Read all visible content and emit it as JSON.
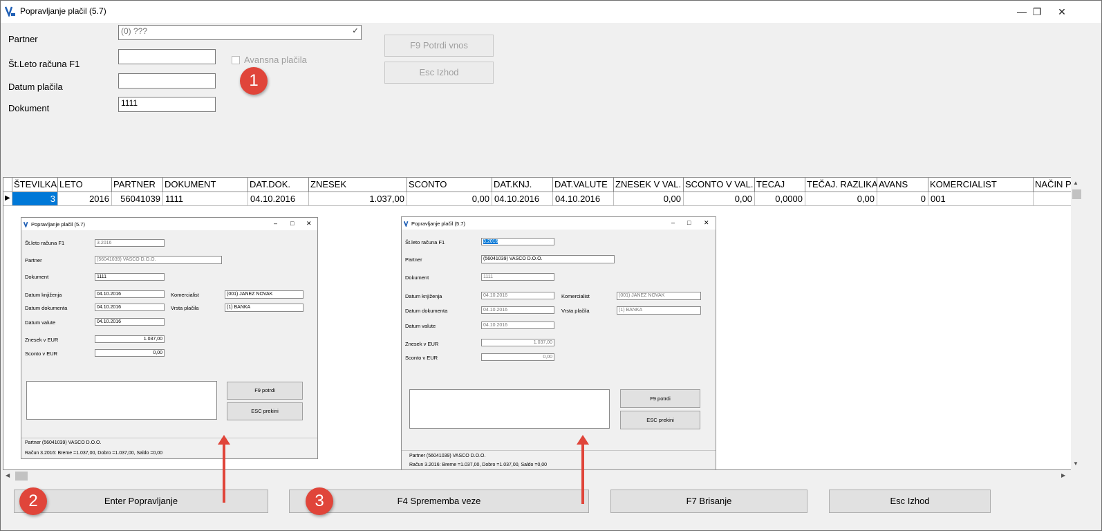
{
  "window": {
    "title": "Popravljanje plačil  (5.7)",
    "minimize": "—",
    "restore": "❐",
    "close": "✕"
  },
  "form": {
    "partner_label": "Partner",
    "partner_value": "(0) ???",
    "racun_label": "Št.Leto računa F1",
    "racun_value": "",
    "datum_label": "Datum plačila",
    "datum_value": "",
    "dokument_label": "Dokument",
    "dokument_value": "1111",
    "avansna_label": "Avansna plačila",
    "confirm_button": "F9  Potrdi vnos",
    "exit_button": "Esc  Izhod"
  },
  "grid": {
    "columns": [
      "ŠTEVILKA",
      "LETO",
      "PARTNER",
      "DOKUMENT",
      "DAT.DOK.",
      "ZNESEK",
      "SCONTO",
      "DAT.KNJ.",
      "DAT.VALUTE",
      "ZNESEK V VAL.",
      "SCONTO V VAL.",
      "TECAJ",
      "TEČAJ. RAZLIKA",
      "AVANS",
      "KOMERCIALIST",
      "NAČIN P"
    ],
    "rows": [
      [
        "3",
        "2016",
        "56041039",
        "1111",
        "04.10.2016",
        "1.037,00",
        "0,00",
        "04.10.2016",
        "04.10.2016",
        "0,00",
        "0,00",
        "0,0000",
        "0,00",
        "0",
        "001",
        ""
      ]
    ]
  },
  "dialog_left": {
    "title": "Popravljanje plačil  (5.7)",
    "racun_label": "Št.leto računa F1",
    "racun_value": "3.2016",
    "partner_label": "Partner",
    "partner_value": "(56041039) VASCO D.O.O.",
    "dokument_label": "Dokument",
    "dokument_value": "1111",
    "dknj_label": "Datum knjiženja",
    "dknj_value": "04.10.2016",
    "ddok_label": "Datum dokumenta",
    "ddok_value": "04.10.2016",
    "dval_label": "Datum valute",
    "dval_value": "04.10.2016",
    "kom_label": "Komercialist",
    "kom_value": "(001) JANEZ NOVAK",
    "vrsta_label": "Vrsta plačila",
    "vrsta_value": "(1) BANKA",
    "znesek_label": "Znesek v EUR",
    "znesek_value": "1.037,00",
    "sconto_label": "Sconto v EUR",
    "sconto_value": "0,00",
    "ok_button": "F9  potrdi",
    "cancel_button": "ESC  prekini",
    "status1": "Partner  (56041039) VASCO D.O.O.",
    "status2": "Račun  3.2016:  Breme =1.037,00,  Dobro =1.037,00,  Saldo =0,00"
  },
  "dialog_right": {
    "title": "Popravljanje plačil  (5.7)",
    "racun_label": "Št.leto računa F1",
    "racun_value": "3.2016",
    "partner_label": "Partner",
    "partner_value": "(56041039) VASCO D.O.O.",
    "dokument_label": "Dokument",
    "dokument_value": "1111",
    "dknj_label": "Datum knjiženja",
    "dknj_value": "04.10.2016",
    "ddok_label": "Datum dokumenta",
    "ddok_value": "04.10.2016",
    "dval_label": "Datum valute",
    "dval_value": "04.10.2016",
    "kom_label": "Komercialist",
    "kom_value": "(001) JANEZ NOVAK",
    "vrsta_label": "Vrsta plačila",
    "vrsta_value": "(1) BANKA",
    "znesek_label": "Znesek v EUR",
    "znesek_value": "1.037,00",
    "sconto_label": "Sconto v EUR",
    "sconto_value": "0,00",
    "ok_button": "F9  potrdi",
    "cancel_button": "ESC  prekini",
    "status1": "Partner  (56041039) VASCO D.O.O.",
    "status2": "Račun  3.2016:  Breme =1.037,00,  Dobro =1.037,00,  Saldo =0,00"
  },
  "bottom_buttons": {
    "edit": "Enter  Popravljanje",
    "link": "F4  Sprememba veze",
    "delete": "F7  Brisanje",
    "exit": "Esc  Izhod"
  },
  "badges": [
    "1",
    "2",
    "3"
  ],
  "colors": {
    "badge": "#e0453a",
    "selection": "#0078d7"
  }
}
